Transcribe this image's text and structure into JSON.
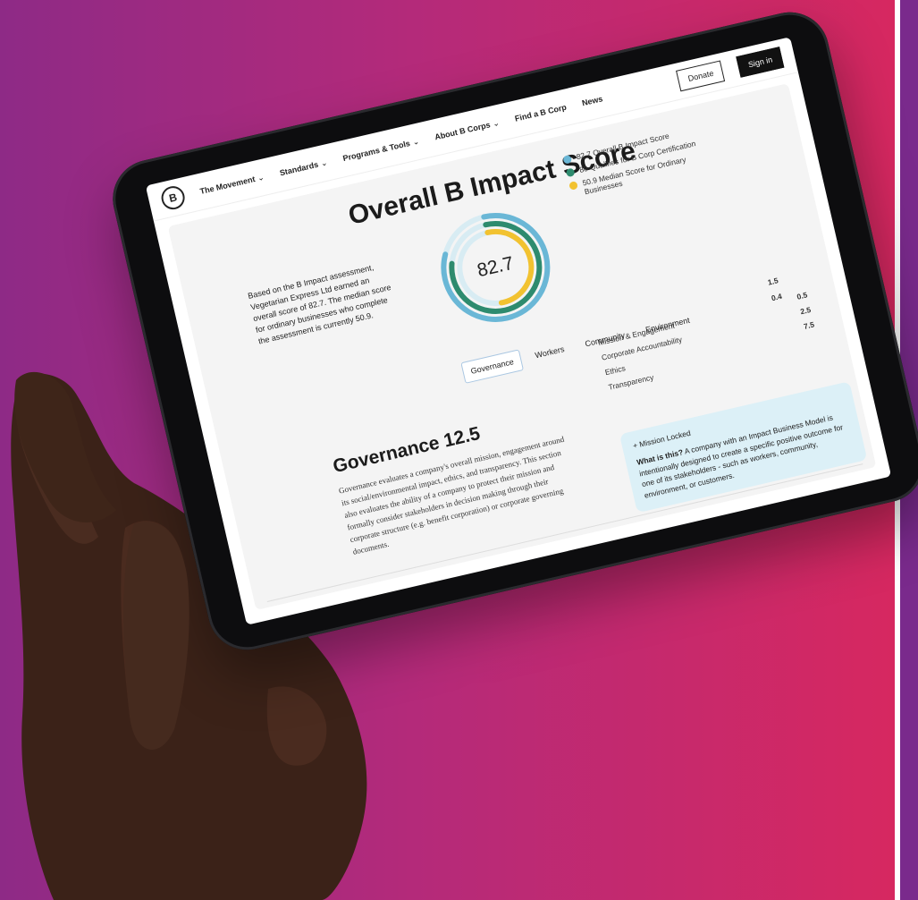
{
  "nav": {
    "items": [
      "The Movement",
      "Standards",
      "Programs & Tools",
      "About B Corps",
      "Find a B Corp",
      "News"
    ],
    "chevron": "⌄",
    "donate": "Donate",
    "sign_in": "Sign in",
    "logo_letter": "B"
  },
  "score": {
    "title": "Overall B Impact Score",
    "value": "82.7",
    "summary": "Based on the B Impact assessment, Vegetarian Express Ltd earned an overall score of 82.7. The median score for ordinary businesses who complete the assessment is currently 50.9.",
    "legend": [
      {
        "label": "82.7 Overall B Impact Score",
        "color": "#6ab7d6"
      },
      {
        "label": "80 Qualifies for B Corp Certification",
        "color": "#2e8b6e"
      },
      {
        "label": "50.9 Median Score for Ordinary Businesses",
        "color": "#f2c230"
      }
    ]
  },
  "tabs": [
    "Governance",
    "Workers",
    "Community",
    "Environment"
  ],
  "governance": {
    "title": "Governance 12.5",
    "description": "Governance evaluates a company's overall mission, engagement around its social/environmental impact, ethics, and transparency. This section also evaluates the ability of a company to protect their mission and formally consider stakeholders in decision making through their corporate structure (e.g. benefit corporation) or corporate governing documents."
  },
  "metrics": {
    "top_values": [
      "1.5",
      "0.4"
    ],
    "rows": [
      {
        "label": "Mission & Engagement",
        "value": "0.5"
      },
      {
        "label": "Corporate Accountability",
        "value": "2.5"
      },
      {
        "label": "Ethics",
        "value": "7.5"
      },
      {
        "label": "Transparency",
        "value": ""
      }
    ]
  },
  "mission": {
    "tag": "+ Mission Locked",
    "question": "What is this?",
    "answer": "A company with an Impact Business Model is intentionally designed to create a specific positive outcome for one of its stakeholders - such as workers, community, environment, or customers."
  }
}
